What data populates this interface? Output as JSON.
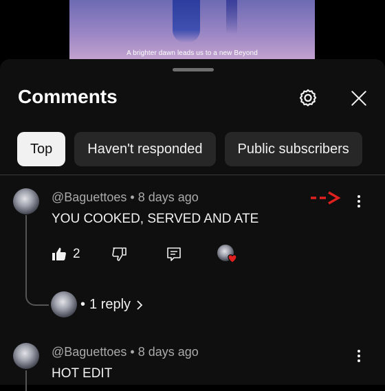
{
  "video": {
    "caption": "A brighter dawn leads us to a new Beyond"
  },
  "header": {
    "title": "Comments"
  },
  "filters": [
    {
      "label": "Top",
      "active": true
    },
    {
      "label": "Haven't responded",
      "active": false
    },
    {
      "label": "Public subscribers",
      "active": false
    }
  ],
  "comments": [
    {
      "author": "@Baguettoes",
      "time": "8 days ago",
      "text": "YOU COOKED, SERVED AND ATE",
      "likes": "2",
      "replies": "1 reply"
    },
    {
      "author": "@Baguettoes",
      "time": "8 days ago",
      "text": "HOT EDIT"
    }
  ],
  "colors": {
    "sheet_bg": "#0f0f0f",
    "chip_bg": "#272727",
    "chip_active_bg": "#f1f1f1",
    "annotation_arrow": "#e0201f",
    "heart": "#e0201f"
  },
  "icons": [
    "settings-icon",
    "close-icon",
    "like-icon",
    "dislike-icon",
    "reply-icon",
    "more-vert-icon",
    "chevron-right-icon",
    "heart-icon",
    "arrow-right-icon"
  ]
}
